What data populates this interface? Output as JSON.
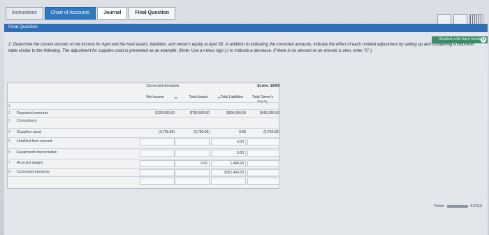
{
  "tabs": [
    {
      "label": "Instructions",
      "state": "normal"
    },
    {
      "label": "Chart of Accounts",
      "state": "blue"
    },
    {
      "label": "Journal",
      "state": "active"
    },
    {
      "label": "Final Question",
      "state": "last"
    }
  ],
  "section": {
    "title": "Final Question"
  },
  "banner": {
    "label": "Shaded cells have feedback"
  },
  "instructions": "2. Determine the correct amount of net income for April and the total assets, liabilities, and owner's equity at April 30. In addition to indicating the corrected amounts, indicate the effect of each omitted adjustment by setting up and completing a columnar table similar to the following. The adjustment for supplies used is presented as an example. (Note: Use a minus sign (-) to indicate a decrease. If there is no amount or an amount is zero, enter \"0\".)",
  "table": {
    "corrected_heading": "Corrected Amounts",
    "score": "Score: 19/60",
    "columns": [
      "Net Income",
      "Total Assets",
      "Total Liabilities",
      "Total Owner's Equity"
    ],
    "operators": [
      "=",
      "+"
    ],
    "rows": [
      {
        "num": "1",
        "label": "",
        "values": [
          "",
          "",
          "",
          ""
        ]
      },
      {
        "num": "2",
        "label": "Reported amounts",
        "values": [
          "$120,000.00",
          "$750,000.00",
          "$300,000.00",
          "$450,000.00"
        ]
      },
      {
        "num": "3",
        "label": "Corrections:",
        "values": [
          "",
          "",
          "",
          ""
        ]
      },
      {
        "num": "4",
        "label": "Supplies used",
        "values": [
          "(2,750.00)",
          "(2,750.00)",
          "0.00",
          "(2,750.00)"
        ]
      },
      {
        "num": "5",
        "label": "Unbilled fees earned",
        "values": [
          "",
          "",
          "0.00",
          ""
        ]
      },
      {
        "num": "6",
        "label": "Equipment depreciation",
        "values": [
          "",
          "",
          "0.00",
          ""
        ]
      },
      {
        "num": "7",
        "label": "Accrued wages",
        "values": [
          "",
          "0.00",
          "1,400.00",
          ""
        ]
      },
      {
        "num": "8",
        "label": "Corrected amounts",
        "values": [
          "",
          "",
          "$301,400.00",
          ""
        ]
      }
    ]
  },
  "footer": {
    "points_label": "Points:",
    "points_value": "5.07/15"
  },
  "colors": {
    "section_bar": "#2e6fb8",
    "banner": "#3b8e6b",
    "tab_blue": "#2e79c2"
  }
}
